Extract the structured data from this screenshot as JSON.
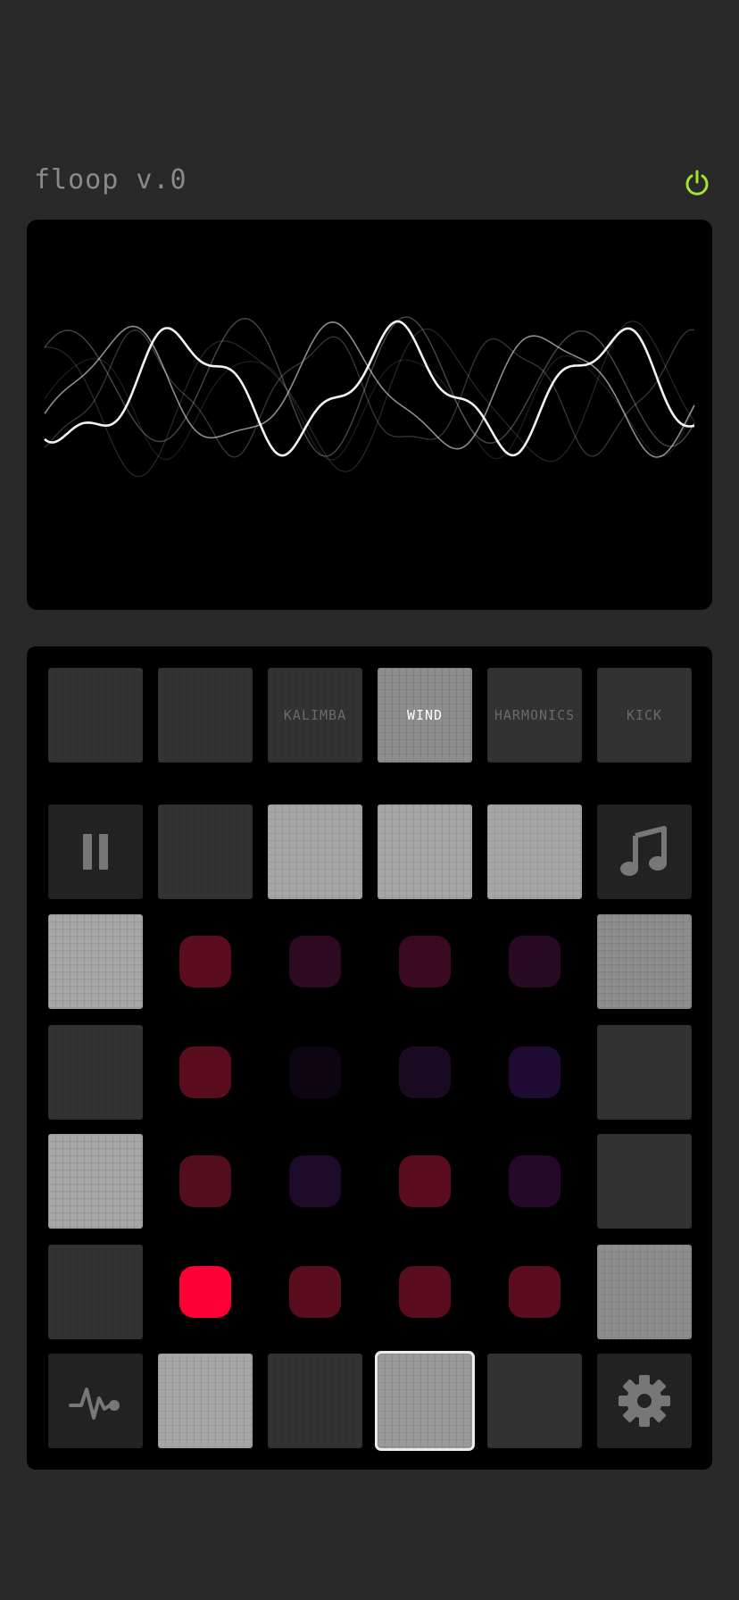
{
  "header": {
    "app_title": "floop v.0",
    "power_icon": "power-icon",
    "power_color": "#a6e22e"
  },
  "instruments": [
    {
      "label": "",
      "active": false
    },
    {
      "label": "",
      "active": false
    },
    {
      "label": "KALIMBA",
      "active": false
    },
    {
      "label": "WIND",
      "active": true
    },
    {
      "label": "HARMONICS",
      "active": false
    },
    {
      "label": "KICK",
      "active": false
    }
  ],
  "transport": {
    "left_icon": "pause-icon",
    "right_icon": "music-note-icon"
  },
  "bottom_bar": {
    "left_icon": "waveform-icon",
    "right_icon": "gear-icon"
  },
  "pad_grid": {
    "rows": [
      [
        "#5a0d1f",
        "#2d0a22",
        "#3a0a22",
        "#2a0a22"
      ],
      [
        "#5a0d1f",
        "#0d0610",
        "#1a0a22",
        "#1e0a32"
      ],
      [
        "#520d1f",
        "#1e0a2a",
        "#5a0d1f",
        "#26092a"
      ],
      [
        "#ff0034",
        "#5a0d1f",
        "#5a0d1f",
        "#5a0d1f"
      ]
    ]
  },
  "colors": {
    "background": "#292929",
    "panel": "#000000",
    "active_pad": "#ff0034"
  }
}
